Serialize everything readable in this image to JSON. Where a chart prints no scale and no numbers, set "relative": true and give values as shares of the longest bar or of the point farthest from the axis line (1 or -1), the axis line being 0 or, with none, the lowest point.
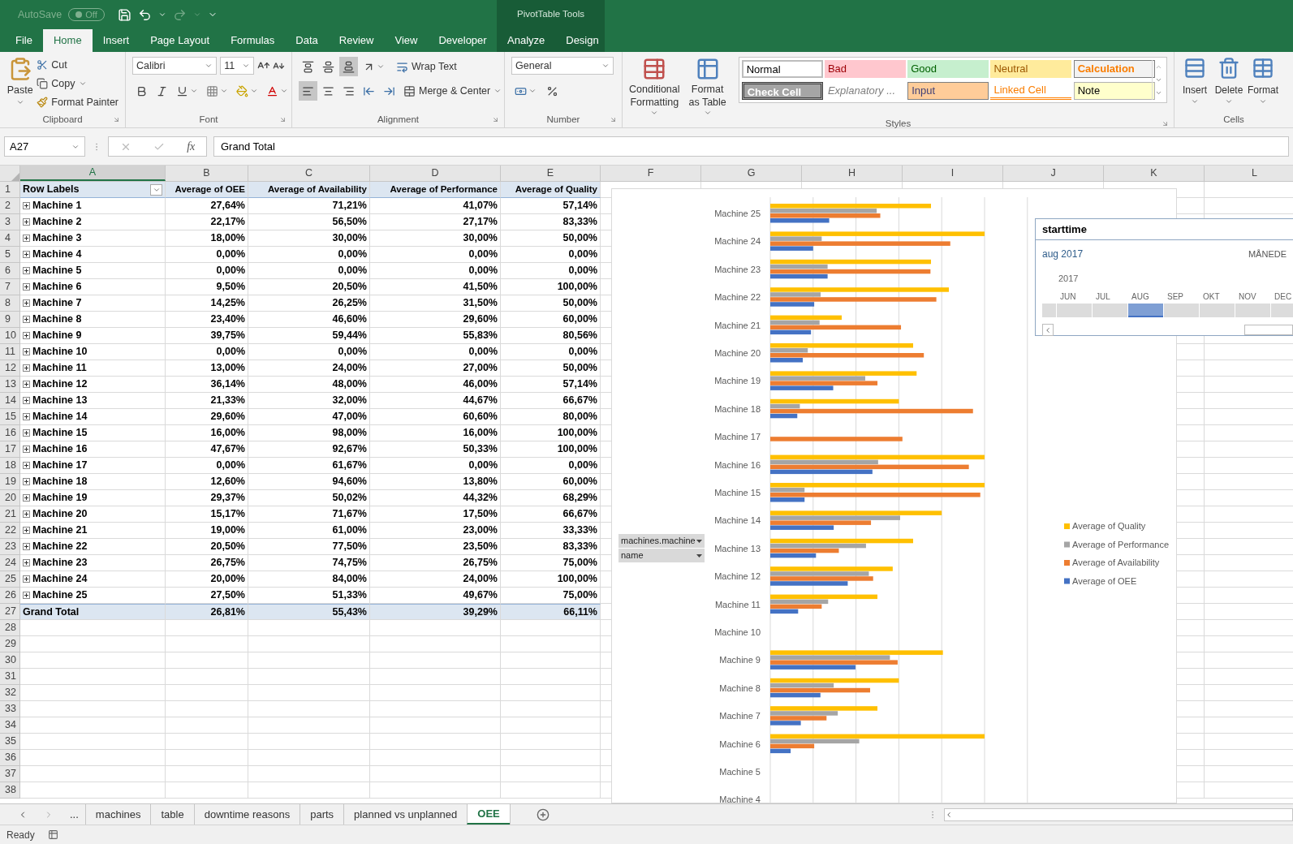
{
  "title_bar": {
    "autosave_label": "AutoSave",
    "autosave_state": "Off",
    "context_group": "PivotTable Tools"
  },
  "ribbon_tabs": [
    {
      "label": "File",
      "selected": false,
      "kind": "standard"
    },
    {
      "label": "Home",
      "selected": true,
      "kind": "standard"
    },
    {
      "label": "Insert",
      "selected": false,
      "kind": "standard"
    },
    {
      "label": "Page Layout",
      "selected": false,
      "kind": "standard"
    },
    {
      "label": "Formulas",
      "selected": false,
      "kind": "standard"
    },
    {
      "label": "Data",
      "selected": false,
      "kind": "standard"
    },
    {
      "label": "Review",
      "selected": false,
      "kind": "standard"
    },
    {
      "label": "View",
      "selected": false,
      "kind": "standard"
    },
    {
      "label": "Developer",
      "selected": false,
      "kind": "standard"
    },
    {
      "label": "Analyze",
      "selected": false,
      "kind": "contextual"
    },
    {
      "label": "Design",
      "selected": false,
      "kind": "contextual"
    }
  ],
  "ribbon": {
    "clipboard": {
      "label": "Clipboard",
      "paste": "Paste",
      "cut": "Cut",
      "copy": "Copy",
      "format_painter": "Format Painter"
    },
    "font": {
      "label": "Font",
      "name": "Calibri",
      "size": "11"
    },
    "alignment": {
      "label": "Alignment",
      "wrap_text": "Wrap Text",
      "merge_center": "Merge & Center",
      "vertical_align": [
        {
          "selected": false
        },
        {
          "selected": false
        },
        {
          "selected": true
        }
      ],
      "horizontal_align": [
        {
          "selected": true
        },
        {
          "selected": false
        },
        {
          "selected": false
        }
      ]
    },
    "number": {
      "label": "Number",
      "format": "General"
    },
    "styles": {
      "label": "Styles",
      "conditional_formatting": "Conditional Formatting",
      "format_as_table": "Format as Table",
      "cell_styles": [
        {
          "label": "Normal",
          "kind": "normal"
        },
        {
          "label": "Bad",
          "kind": "bad"
        },
        {
          "label": "Good",
          "kind": "good"
        },
        {
          "label": "Neutral",
          "kind": "neutral"
        },
        {
          "label": "Calculation",
          "kind": "calculation"
        },
        {
          "label": "Check Cell",
          "kind": "check"
        },
        {
          "label": "Explanatory ...",
          "kind": "explanatory"
        },
        {
          "label": "Input",
          "kind": "input"
        },
        {
          "label": "Linked Cell",
          "kind": "linked"
        },
        {
          "label": "Note",
          "kind": "note"
        }
      ]
    },
    "cells": {
      "label": "Cells",
      "insert": "Insert",
      "delete": "Delete",
      "format": "Format"
    }
  },
  "formula_bar": {
    "name_box": "A27",
    "fx": "fx",
    "formula": "Grand Total"
  },
  "sheet": {
    "columns": [
      {
        "label": "A",
        "selected": true
      },
      {
        "label": "B",
        "selected": false
      },
      {
        "label": "C",
        "selected": false
      },
      {
        "label": "D",
        "selected": false
      },
      {
        "label": "E",
        "selected": false
      },
      {
        "label": "F",
        "selected": false
      },
      {
        "label": "G",
        "selected": false
      },
      {
        "label": "H",
        "selected": false
      },
      {
        "label": "I",
        "selected": false
      },
      {
        "label": "J",
        "selected": false
      },
      {
        "label": "K",
        "selected": false
      },
      {
        "label": "L",
        "selected": false
      }
    ],
    "row_numbers": [
      "1",
      "2",
      "3",
      "4",
      "5",
      "6",
      "7",
      "8",
      "9",
      "10",
      "11",
      "12",
      "13",
      "14",
      "15",
      "16",
      "17",
      "18",
      "19",
      "20",
      "21",
      "22",
      "23",
      "24",
      "25",
      "26",
      "27",
      "28",
      "29",
      "30",
      "31",
      "32",
      "33",
      "34",
      "35",
      "36",
      "37",
      "38"
    ],
    "pivot": {
      "row_labels": "Row Labels",
      "headers": [
        "Average of OEE",
        "Average of Availability",
        "Average of Performance",
        "Average of Quality"
      ],
      "rows": [
        {
          "label": "Machine 1",
          "values": [
            "27,64%",
            "71,21%",
            "41,07%",
            "57,14%"
          ]
        },
        {
          "label": "Machine 2",
          "values": [
            "22,17%",
            "56,50%",
            "27,17%",
            "83,33%"
          ]
        },
        {
          "label": "Machine 3",
          "values": [
            "18,00%",
            "30,00%",
            "30,00%",
            "50,00%"
          ]
        },
        {
          "label": "Machine 4",
          "values": [
            "0,00%",
            "0,00%",
            "0,00%",
            "0,00%"
          ]
        },
        {
          "label": "Machine 5",
          "values": [
            "0,00%",
            "0,00%",
            "0,00%",
            "0,00%"
          ]
        },
        {
          "label": "Machine 6",
          "values": [
            "9,50%",
            "20,50%",
            "41,50%",
            "100,00%"
          ]
        },
        {
          "label": "Machine 7",
          "values": [
            "14,25%",
            "26,25%",
            "31,50%",
            "50,00%"
          ]
        },
        {
          "label": "Machine 8",
          "values": [
            "23,40%",
            "46,60%",
            "29,60%",
            "60,00%"
          ]
        },
        {
          "label": "Machine 9",
          "values": [
            "39,75%",
            "59,44%",
            "55,83%",
            "80,56%"
          ]
        },
        {
          "label": "Machine 10",
          "values": [
            "0,00%",
            "0,00%",
            "0,00%",
            "0,00%"
          ]
        },
        {
          "label": "Machine 11",
          "values": [
            "13,00%",
            "24,00%",
            "27,00%",
            "50,00%"
          ]
        },
        {
          "label": "Machine 12",
          "values": [
            "36,14%",
            "48,00%",
            "46,00%",
            "57,14%"
          ]
        },
        {
          "label": "Machine 13",
          "values": [
            "21,33%",
            "32,00%",
            "44,67%",
            "66,67%"
          ]
        },
        {
          "label": "Machine 14",
          "values": [
            "29,60%",
            "47,00%",
            "60,60%",
            "80,00%"
          ]
        },
        {
          "label": "Machine 15",
          "values": [
            "16,00%",
            "98,00%",
            "16,00%",
            "100,00%"
          ]
        },
        {
          "label": "Machine 16",
          "values": [
            "47,67%",
            "92,67%",
            "50,33%",
            "100,00%"
          ]
        },
        {
          "label": "Machine 17",
          "values": [
            "0,00%",
            "61,67%",
            "0,00%",
            "0,00%"
          ]
        },
        {
          "label": "Machine 18",
          "values": [
            "12,60%",
            "94,60%",
            "13,80%",
            "60,00%"
          ]
        },
        {
          "label": "Machine 19",
          "values": [
            "29,37%",
            "50,02%",
            "44,32%",
            "68,29%"
          ]
        },
        {
          "label": "Machine 20",
          "values": [
            "15,17%",
            "71,67%",
            "17,50%",
            "66,67%"
          ]
        },
        {
          "label": "Machine 21",
          "values": [
            "19,00%",
            "61,00%",
            "23,00%",
            "33,33%"
          ]
        },
        {
          "label": "Machine 22",
          "values": [
            "20,50%",
            "77,50%",
            "23,50%",
            "83,33%"
          ]
        },
        {
          "label": "Machine 23",
          "values": [
            "26,75%",
            "74,75%",
            "26,75%",
            "75,00%"
          ]
        },
        {
          "label": "Machine 24",
          "values": [
            "20,00%",
            "84,00%",
            "24,00%",
            "100,00%"
          ]
        },
        {
          "label": "Machine 25",
          "values": [
            "27,50%",
            "51,33%",
            "49,67%",
            "75,00%"
          ]
        }
      ],
      "total": {
        "label": "Grand Total",
        "values": [
          "26,81%",
          "55,43%",
          "39,29%",
          "66,11%"
        ]
      }
    }
  },
  "chart": {
    "field_buttons": [
      "machines.machine",
      "name"
    ],
    "chart_data": {
      "type": "bar",
      "orientation": "horizontal",
      "relative": true,
      "legend": "right",
      "xlim": [
        0,
        1.2
      ],
      "categories": [
        "Machine 25",
        "Machine 24",
        "Machine 23",
        "Machine 22",
        "Machine 21",
        "Machine 20",
        "Machine 19",
        "Machine 18",
        "Machine 17",
        "Machine 16",
        "Machine 15",
        "Machine 14",
        "Machine 13",
        "Machine 12",
        "Machine 11",
        "Machine 10",
        "Machine 9",
        "Machine 8",
        "Machine 7",
        "Machine 6",
        "Machine 5",
        "Machine 4"
      ],
      "series": [
        {
          "name": "Average of OEE",
          "color": "#4472c4",
          "values": [
            0.275,
            0.2,
            0.2675,
            0.205,
            0.19,
            0.1517,
            0.2937,
            0.126,
            0,
            0.4767,
            0.16,
            0.296,
            0.2133,
            0.3614,
            0.13,
            0,
            0.3975,
            0.234,
            0.1425,
            0.095,
            0,
            0
          ]
        },
        {
          "name": "Average of Availability",
          "color": "#ed7d31",
          "values": [
            0.5133,
            0.84,
            0.7475,
            0.775,
            0.61,
            0.7167,
            0.5002,
            0.946,
            0.6167,
            0.9267,
            0.98,
            0.47,
            0.32,
            0.48,
            0.24,
            0,
            0.5944,
            0.466,
            0.2625,
            0.205,
            0,
            0
          ]
        },
        {
          "name": "Average of Performance",
          "color": "#a5a5a5",
          "values": [
            0.4967,
            0.24,
            0.2675,
            0.235,
            0.23,
            0.175,
            0.4432,
            0.138,
            0,
            0.5033,
            0.16,
            0.606,
            0.4467,
            0.46,
            0.27,
            0,
            0.5583,
            0.296,
            0.315,
            0.415,
            0,
            0
          ]
        },
        {
          "name": "Average of Quality",
          "color": "#ffc000",
          "values": [
            0.75,
            1,
            0.75,
            0.8333,
            0.3333,
            0.6667,
            0.6829,
            0.6,
            0,
            1,
            1,
            0.8,
            0.6667,
            0.5714,
            0.5,
            0,
            0.8056,
            0.6,
            0.5,
            1,
            0,
            0
          ]
        }
      ]
    }
  },
  "slicer": {
    "title": "starttime",
    "selection": "aug 2017",
    "level": "MÅNEDE",
    "year": "2017",
    "months": [
      {
        "label": "JUN",
        "selected": false
      },
      {
        "label": "JUL",
        "selected": false
      },
      {
        "label": "AUG",
        "selected": true
      },
      {
        "label": "SEP",
        "selected": false
      },
      {
        "label": "OKT",
        "selected": false
      },
      {
        "label": "NOV",
        "selected": false
      },
      {
        "label": "DEC",
        "selected": false
      }
    ]
  },
  "sheet_tabs": {
    "more": "...",
    "tabs": [
      {
        "label": "machines",
        "selected": false
      },
      {
        "label": "table",
        "selected": false
      },
      {
        "label": "downtime reasons",
        "selected": false
      },
      {
        "label": "parts",
        "selected": false
      },
      {
        "label": "planned vs unplanned",
        "selected": false
      },
      {
        "label": "OEE",
        "selected": true
      }
    ]
  },
  "status_bar": {
    "status": "Ready"
  }
}
